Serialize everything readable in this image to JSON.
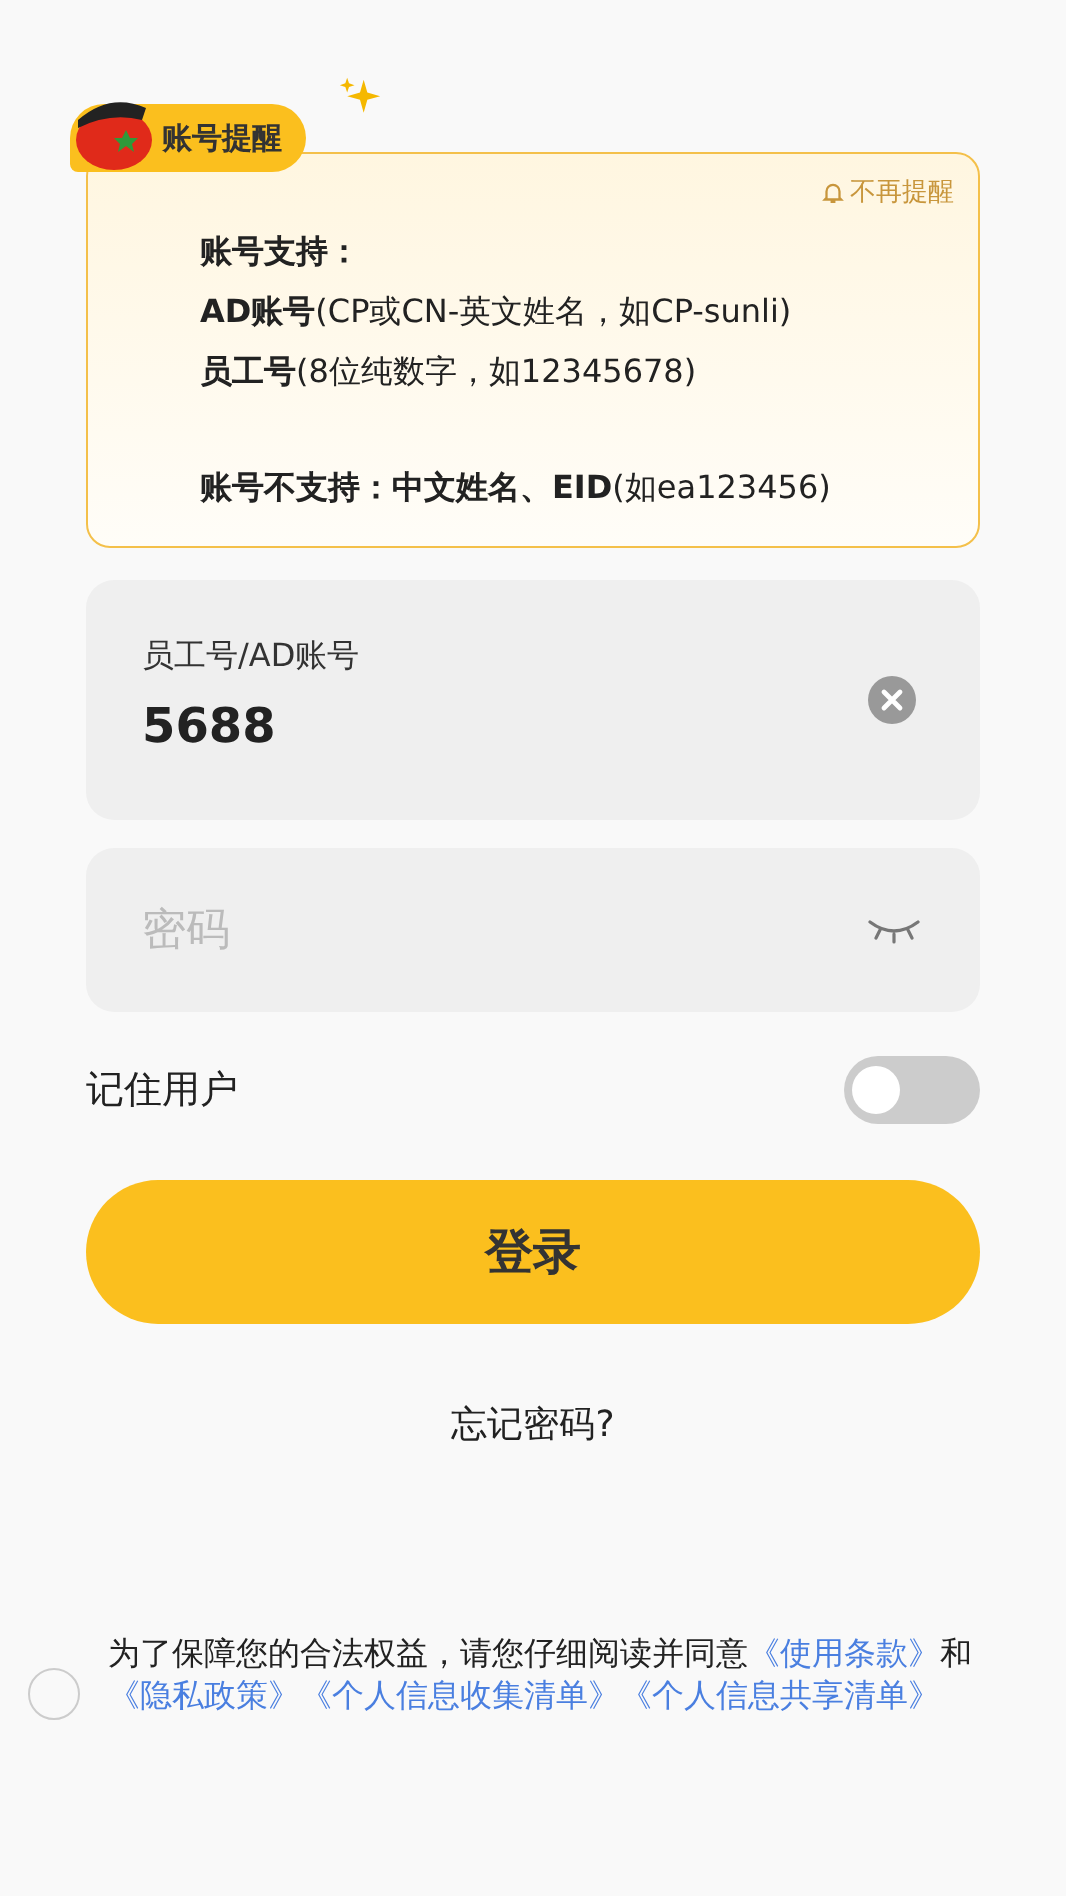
{
  "notice": {
    "badge": "账号提醒",
    "dismiss": "不再提醒",
    "supported_title": "账号支持：",
    "supported": [
      "**AD账号**(CP或CN-英文姓名，如CP-sunli)",
      "**员工号**(8位纯数字，如12345678)"
    ],
    "unsupported": "**账号不支持：中文姓名、EID**(如ea123456)"
  },
  "account": {
    "label": "员工号/AD账号",
    "value": "5688"
  },
  "password": {
    "placeholder": "密码"
  },
  "remember": {
    "label": "记住用户",
    "on": false
  },
  "login_button": "登录",
  "forgot": "忘记密码?",
  "agreement": {
    "checked": false,
    "text": "为了保障您的合法权益，请您仔细阅读并同意",
    "links": [
      {
        "label": "《使用条款》"
      },
      {
        "prefix": "和",
        "label": "《隐私政策》"
      },
      {
        "label": "《个人信息收集清单》"
      },
      {
        "label": "《个人信息共享清单》"
      }
    ]
  }
}
